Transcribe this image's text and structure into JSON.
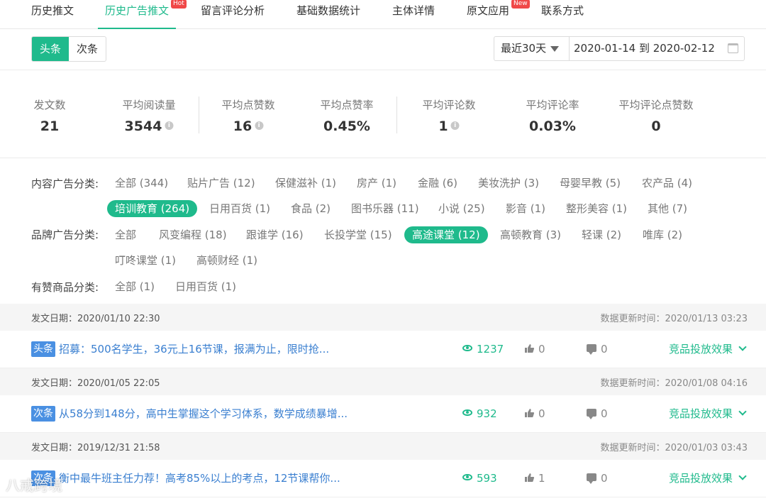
{
  "nav": {
    "tabs": [
      {
        "label": "历史推文"
      },
      {
        "label": "历史广告推文",
        "badge": "Hot"
      },
      {
        "label": "留言评论分析"
      },
      {
        "label": "基础数据统计"
      },
      {
        "label": "主体详情"
      },
      {
        "label": "原文应用",
        "badge": "New"
      },
      {
        "label": "联系方式"
      }
    ],
    "active_index": 1
  },
  "toolbar": {
    "segments": [
      "头条",
      "次条"
    ],
    "active_segment": "头条",
    "range_select": "最近30天",
    "date_range": "2020-01-14 到 2020-02-12"
  },
  "stats": [
    {
      "label": "发文数",
      "value": "21"
    },
    {
      "label": "平均阅读量",
      "value": "3544"
    },
    {
      "label": "平均点赞数",
      "value": "16"
    },
    {
      "label": "平均点赞率",
      "value": "0.45%"
    },
    {
      "label": "平均评论数",
      "value": "1"
    },
    {
      "label": "平均评论率",
      "value": "0.03%"
    },
    {
      "label": "平均评论点赞数",
      "value": "0"
    }
  ],
  "filters": {
    "content": {
      "label": "内容广告分类:",
      "chips": [
        "全部 (344)",
        "贴片广告 (12)",
        "保健滋补 (1)",
        "房产 (1)",
        "金融 (6)",
        "美妆洗护 (3)",
        "母婴早教 (5)",
        "农产品 (4)",
        "培训教育 (264)",
        "日用百货 (1)",
        "食品 (2)",
        "图书乐器 (11)",
        "小说 (25)",
        "影音 (1)",
        "整形美容 (1)",
        "其他 (7)"
      ],
      "selected": "培训教育 (264)"
    },
    "brand": {
      "label": "品牌广告分类:",
      "chips": [
        "全部",
        "风变编程 (18)",
        "跟谁学 (16)",
        "长投学堂 (15)",
        "高途课堂 (12)",
        "高顿教育 (3)",
        "轻课 (2)",
        "唯库 (2)",
        "叮咚课堂 (1)",
        "高顿财经 (1)"
      ],
      "selected": "高途课堂 (12)"
    },
    "liked": {
      "label": "有赞商品分类:",
      "chips": [
        "全部 (1)",
        "日用百货 (1)"
      ]
    }
  },
  "posts": [
    {
      "post_date": "发文日期：2020/01/10 22:30",
      "update": "数据更新时间：2020/01/13 03:23",
      "tag": "头条",
      "title": "招募：500名学生，36元上16节课，报满为止，限时抢...",
      "views": "1237",
      "likes": "0",
      "comments": "0",
      "effect": "竞品投放效果"
    },
    {
      "post_date": "发文日期：2020/01/05 22:05",
      "update": "数据更新时间：2020/01/08 04:16",
      "tag": "次条",
      "title": "从58分到148分，高中生掌握这个学习体系，数学成绩暴增...",
      "views": "932",
      "likes": "0",
      "comments": "0",
      "effect": "竞品投放效果"
    },
    {
      "post_date": "发文日期：2019/12/31 21:58",
      "update": "数据更新时间：2020/01/03 03:43",
      "tag": "次条",
      "title": "衡中最牛班主任力荐！高考85%以上的考点，12节课帮你...",
      "views": "593",
      "likes": "1",
      "comments": "0",
      "effect": "竞品投放效果"
    }
  ],
  "watermark": "八戒跨境",
  "colors": {
    "accent": "#1fba8c",
    "tag_blue": "#4a90e2",
    "link": "#3a7fd0",
    "badge_red": "#f04848"
  }
}
